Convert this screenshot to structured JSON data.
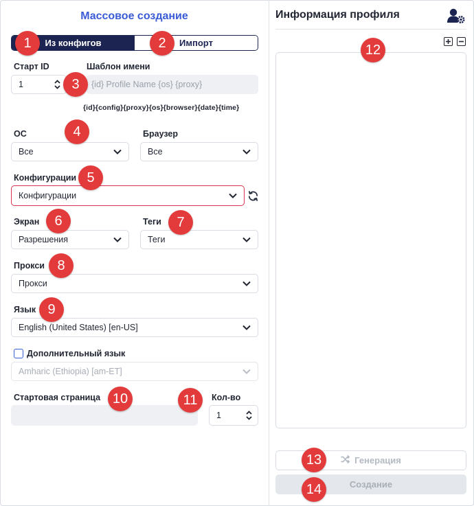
{
  "left": {
    "title": "Массовое создание",
    "tabs": [
      {
        "label": "Из конфигов",
        "active": true
      },
      {
        "label": "Импорт",
        "active": false
      }
    ],
    "start_id": {
      "label": "Старт ID",
      "value": "1"
    },
    "name_template": {
      "label": "Шаблон имени",
      "placeholder": "{id} Profile Name {os} {proxy}"
    },
    "template_hint": "{id}{config}{proxy}{os}{browser}{date}{time}",
    "os": {
      "label": "ОС",
      "value": "Все"
    },
    "browser": {
      "label": "Браузер",
      "value": "Все"
    },
    "configs": {
      "label": "Конфигурации",
      "value": "Конфигурации"
    },
    "screen": {
      "label": "Экран",
      "value": "Разрешения"
    },
    "tags": {
      "label": "Теги",
      "value": "Теги"
    },
    "proxy": {
      "label": "Прокси",
      "value": "Прокси"
    },
    "language": {
      "label": "Язык",
      "value": "English (United States) [en-US]"
    },
    "extra_language": {
      "label": "Дополнительный язык",
      "checked": false,
      "value": "Amharic (Ethiopia) [am-ET]"
    },
    "start_page": {
      "label": "Стартовая страница",
      "value": ""
    },
    "count": {
      "label": "Кол-во",
      "value": "1"
    }
  },
  "right": {
    "title": "Информация профиля",
    "generate_label": "Генерация",
    "create_label": "Создание"
  },
  "badges": [
    "1",
    "2",
    "3",
    "4",
    "5",
    "6",
    "7",
    "8",
    "9",
    "10",
    "11",
    "12",
    "13",
    "14"
  ],
  "icons": {
    "profile_settings": "user-gear-icon",
    "expand": "plus-square-icon",
    "collapse": "minus-square-icon",
    "refresh": "refresh-icon",
    "shuffle": "shuffle-icon",
    "dropdown": "chevron-down-icon",
    "stepper": "stepper-icon"
  },
  "colors": {
    "accent": "#3a5bd6",
    "toggle_active": "#1c2452",
    "badge": "#e33b3b",
    "highlight_border": "#d9304f"
  }
}
